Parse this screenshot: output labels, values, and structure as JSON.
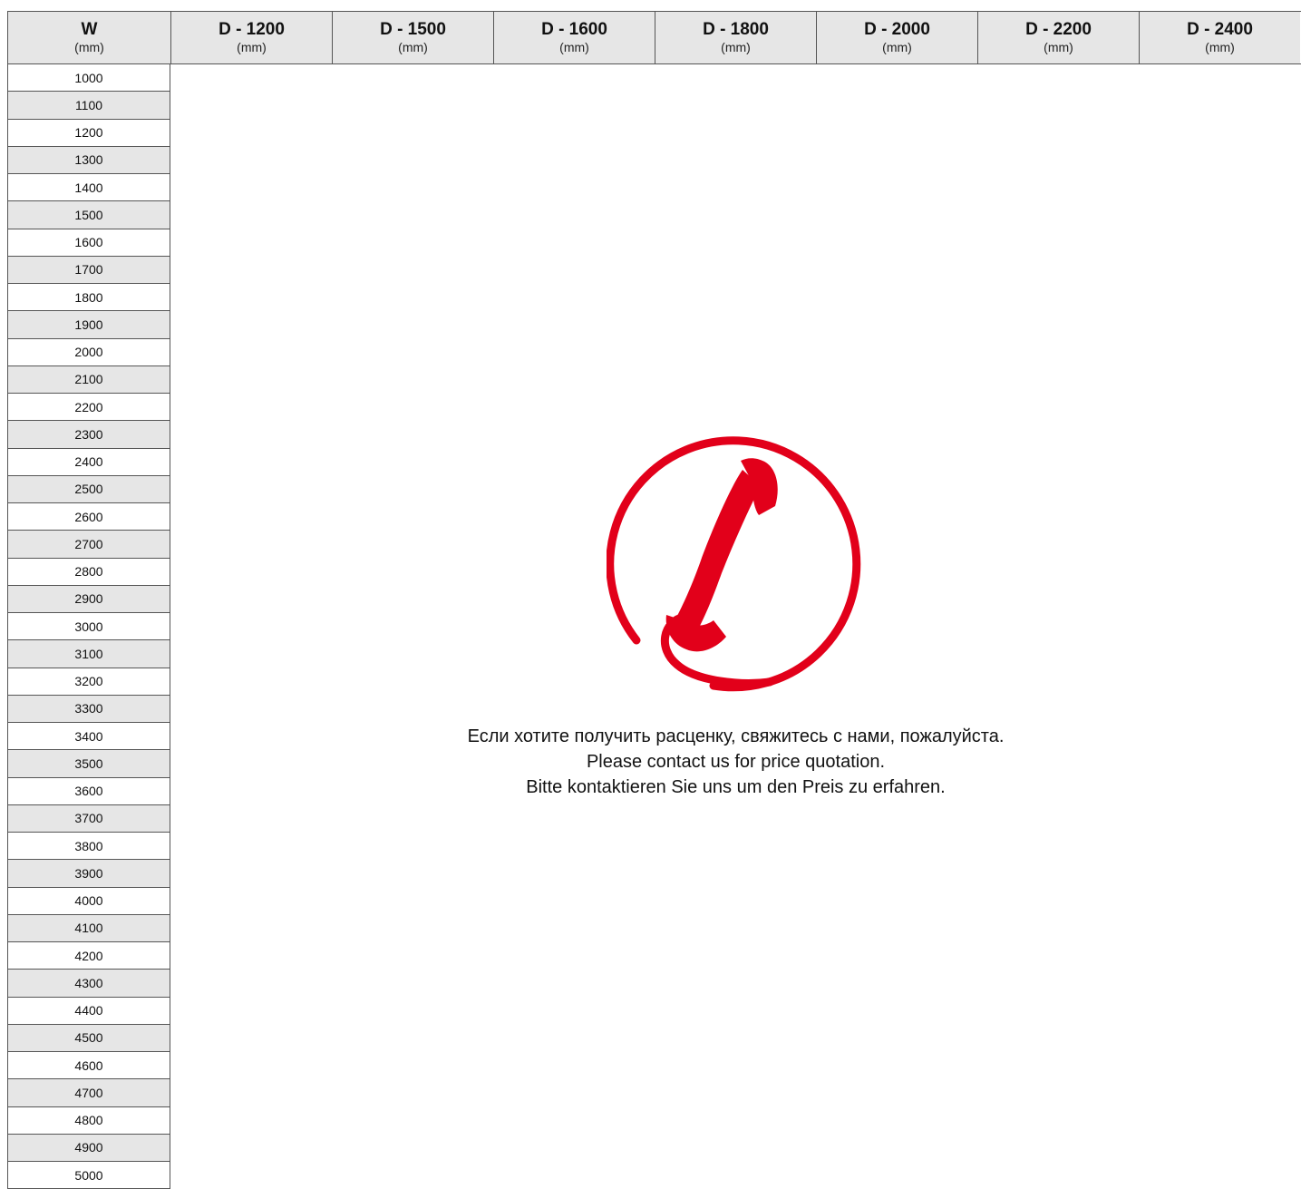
{
  "header": {
    "w_col": {
      "title": "W",
      "unit": "(mm)"
    },
    "d_cols": [
      {
        "title": "D - 1200",
        "unit": "(mm)"
      },
      {
        "title": "D - 1500",
        "unit": "(mm)"
      },
      {
        "title": "D - 1600",
        "unit": "(mm)"
      },
      {
        "title": "D - 1800",
        "unit": "(mm)"
      },
      {
        "title": "D - 2000",
        "unit": "(mm)"
      },
      {
        "title": "D - 2200",
        "unit": "(mm)"
      },
      {
        "title": "D - 2400",
        "unit": "(mm)"
      }
    ]
  },
  "widths": [
    "1000",
    "1100",
    "1200",
    "1300",
    "1400",
    "1500",
    "1600",
    "1700",
    "1800",
    "1900",
    "2000",
    "2100",
    "2200",
    "2300",
    "2400",
    "2500",
    "2600",
    "2700",
    "2800",
    "2900",
    "3000",
    "3100",
    "3200",
    "3300",
    "3400",
    "3500",
    "3600",
    "3700",
    "3800",
    "3900",
    "4000",
    "4100",
    "4200",
    "4300",
    "4400",
    "4500",
    "4600",
    "4700",
    "4800",
    "4900",
    "5000"
  ],
  "notice": {
    "icon": "phone-handset-icon",
    "icon_color": "#e2001a",
    "line_ru": "Если хотите получить расценку, свяжитесь с нами, пожалуйста.",
    "line_en": "Please contact us for price quotation.",
    "line_de": "Bitte kontaktieren Sie uns um den Preis zu erfahren."
  }
}
